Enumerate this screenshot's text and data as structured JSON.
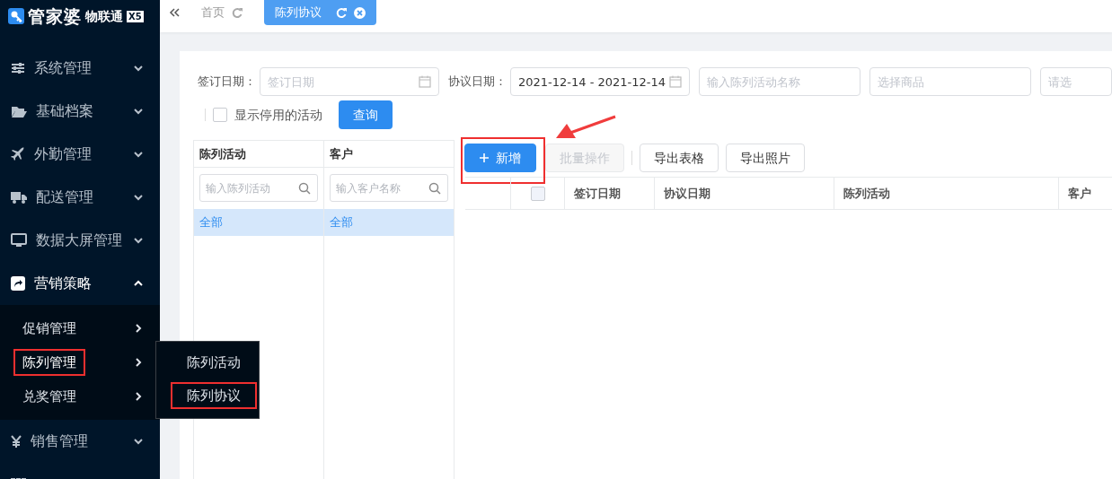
{
  "logo": {
    "name": "管家婆",
    "suffix": "物联通",
    "badge": "X5"
  },
  "tabs": [
    {
      "label": "首页",
      "selected": false
    },
    {
      "label": "陈列协议",
      "selected": true
    }
  ],
  "sidebar": {
    "items": [
      {
        "label": "系统管理",
        "expanded": false
      },
      {
        "label": "基础档案",
        "expanded": false
      },
      {
        "label": "外勤管理",
        "expanded": false
      },
      {
        "label": "配送管理",
        "expanded": false
      },
      {
        "label": "数据大屏管理",
        "expanded": false
      },
      {
        "label": "营销策略",
        "expanded": true,
        "children": [
          {
            "label": "促销管理",
            "highlighted": false
          },
          {
            "label": "陈列管理",
            "highlighted": true
          },
          {
            "label": "兑奖管理",
            "highlighted": false
          }
        ]
      },
      {
        "label": "销售管理",
        "expanded": false
      },
      {
        "expanded": false
      }
    ]
  },
  "flyout": {
    "items": [
      {
        "label": "陈列活动",
        "highlighted": false
      },
      {
        "label": "陈列协议",
        "highlighted": true
      }
    ]
  },
  "filters": [
    {
      "kind": "date",
      "label": "签订日期：",
      "placeholder": "签订日期"
    },
    {
      "kind": "date",
      "label": "协议日期：",
      "value": "2021-12-14 - 2021-12-14"
    },
    {
      "kind": "text",
      "placeholder": "输入陈列活动名称"
    },
    {
      "kind": "text",
      "placeholder": "选择商品"
    },
    {
      "kind": "text",
      "placeholder": "请选"
    }
  ],
  "show_disabled": {
    "label": "显示停用的活动",
    "checked": false
  },
  "query_button": "查询",
  "panes": [
    {
      "title": "陈列活动",
      "placeholder": "输入陈列活动",
      "items": [
        {
          "label": "全部",
          "selected": true
        }
      ]
    },
    {
      "title": "客户",
      "placeholder": "输入客户名称",
      "items": [
        {
          "label": "全部",
          "selected": true
        }
      ]
    }
  ],
  "toolbar": [
    {
      "kind": "primary",
      "label": "新增",
      "highlighted": true
    },
    {
      "kind": "disabled",
      "label": "批量操作",
      "highlighted": false
    },
    {
      "kind": "default",
      "label": "导出表格",
      "highlighted": false
    },
    {
      "kind": "default",
      "label": "导出照片",
      "highlighted": false
    }
  ],
  "table": {
    "all_checked": false,
    "columns": [
      "签订日期",
      "协议日期",
      "陈列活动",
      "客户"
    ]
  }
}
